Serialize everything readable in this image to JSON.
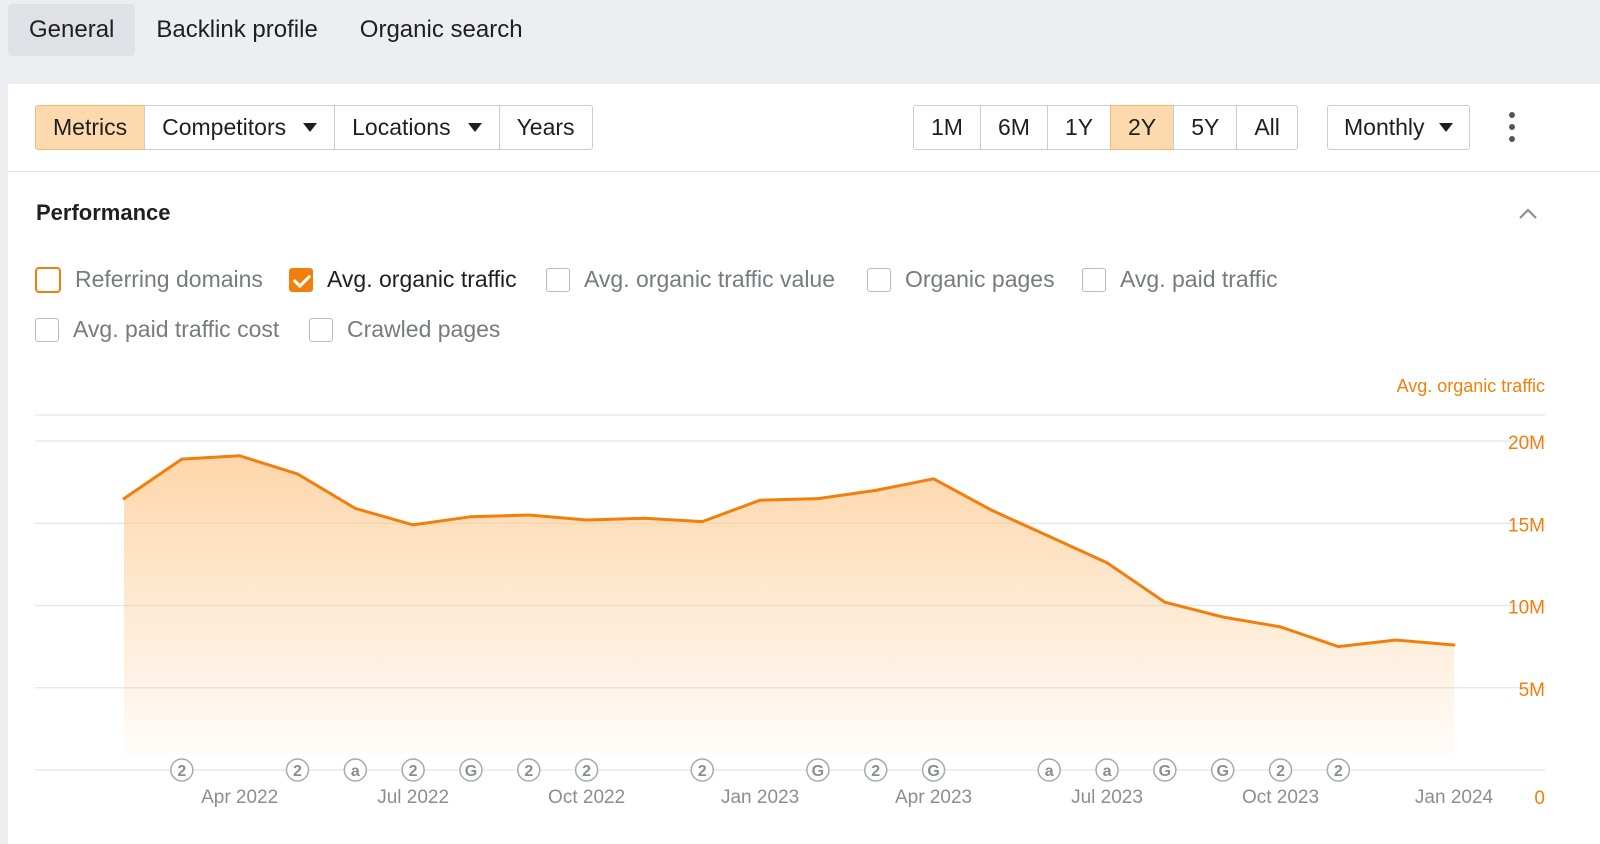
{
  "top_tabs": [
    {
      "label": "General",
      "active": true
    },
    {
      "label": "Backlink profile",
      "active": false
    },
    {
      "label": "Organic search",
      "active": false
    }
  ],
  "toolbar": {
    "metrics_label": "Metrics",
    "competitors_label": "Competitors",
    "locations_label": "Locations",
    "years_label": "Years",
    "ranges": [
      {
        "label": "1M",
        "active": false
      },
      {
        "label": "6M",
        "active": false
      },
      {
        "label": "1Y",
        "active": false
      },
      {
        "label": "2Y",
        "active": true
      },
      {
        "label": "5Y",
        "active": false
      },
      {
        "label": "All",
        "active": false
      }
    ],
    "interval_label": "Monthly",
    "more_icon": "more-vertical-icon"
  },
  "performance": {
    "title": "Performance",
    "collapse_icon": "chevron-up-icon",
    "metrics": [
      {
        "label": "Referring domains",
        "checked": false,
        "highlight": true
      },
      {
        "label": "Avg. organic traffic",
        "checked": true,
        "highlight": false
      },
      {
        "label": "Avg. organic traffic value",
        "checked": false,
        "highlight": false
      },
      {
        "label": "Organic pages",
        "checked": false,
        "highlight": false
      },
      {
        "label": "Avg. paid traffic",
        "checked": false,
        "highlight": false
      },
      {
        "label": "Avg. paid traffic cost",
        "checked": false,
        "highlight": false
      },
      {
        "label": "Crawled pages",
        "checked": false,
        "highlight": false
      }
    ]
  },
  "colors": {
    "accent": "#f27f0c",
    "grid": "#e3e5e9",
    "axis_text": "#8a8e94",
    "active_btn": "#fdd9ae"
  },
  "chart_data": {
    "type": "area",
    "series": [
      {
        "name": "Avg. organic traffic",
        "color": "#f27f0c",
        "x": [
          "2022-02",
          "2022-03",
          "2022-04",
          "2022-05",
          "2022-06",
          "2022-07",
          "2022-08",
          "2022-09",
          "2022-10",
          "2022-11",
          "2022-12",
          "2023-01",
          "2023-02",
          "2023-03",
          "2023-04",
          "2023-05",
          "2023-06",
          "2023-07",
          "2023-08",
          "2023-09",
          "2023-10",
          "2023-11",
          "2023-12",
          "2024-01"
        ],
        "values": [
          16.5,
          18.9,
          19.1,
          18.0,
          15.9,
          14.9,
          15.4,
          15.5,
          15.2,
          15.3,
          15.1,
          16.4,
          16.5,
          17.0,
          17.7,
          15.8,
          14.2,
          12.6,
          10.2,
          9.3,
          8.7,
          7.5,
          7.9,
          7.6
        ]
      }
    ],
    "y_axis_label": "Avg. organic traffic",
    "y_ticks": [
      "20M",
      "15M",
      "10M",
      "5M",
      "0"
    ],
    "y_tick_values": [
      20,
      15,
      10,
      5,
      0
    ],
    "ylim": [
      0,
      20
    ],
    "x_tick_labels": [
      {
        "label": "Apr 2022",
        "x": "2022-04"
      },
      {
        "label": "Jul 2022",
        "x": "2022-07"
      },
      {
        "label": "Oct 2022",
        "x": "2022-10"
      },
      {
        "label": "Jan 2023",
        "x": "2023-01"
      },
      {
        "label": "Apr 2023",
        "x": "2023-04"
      },
      {
        "label": "Jul 2023",
        "x": "2023-07"
      },
      {
        "label": "Oct 2023",
        "x": "2023-10"
      },
      {
        "label": "Jan 2024",
        "x": "2024-01"
      }
    ],
    "annotations": [
      {
        "x": "2022-03",
        "glyph": "2"
      },
      {
        "x": "2022-05",
        "glyph": "2"
      },
      {
        "x": "2022-06",
        "glyph": "a"
      },
      {
        "x": "2022-07",
        "glyph": "2"
      },
      {
        "x": "2022-08",
        "glyph": "G"
      },
      {
        "x": "2022-09",
        "glyph": "2"
      },
      {
        "x": "2022-10",
        "glyph": "2"
      },
      {
        "x": "2022-12",
        "glyph": "2"
      },
      {
        "x": "2023-02",
        "glyph": "G"
      },
      {
        "x": "2023-03",
        "glyph": "2"
      },
      {
        "x": "2023-04",
        "glyph": "G"
      },
      {
        "x": "2023-06",
        "glyph": "a"
      },
      {
        "x": "2023-07",
        "glyph": "a"
      },
      {
        "x": "2023-08",
        "glyph": "G"
      },
      {
        "x": "2023-09",
        "glyph": "G"
      },
      {
        "x": "2023-10",
        "glyph": "2"
      },
      {
        "x": "2023-11",
        "glyph": "2"
      }
    ],
    "grid": true
  }
}
